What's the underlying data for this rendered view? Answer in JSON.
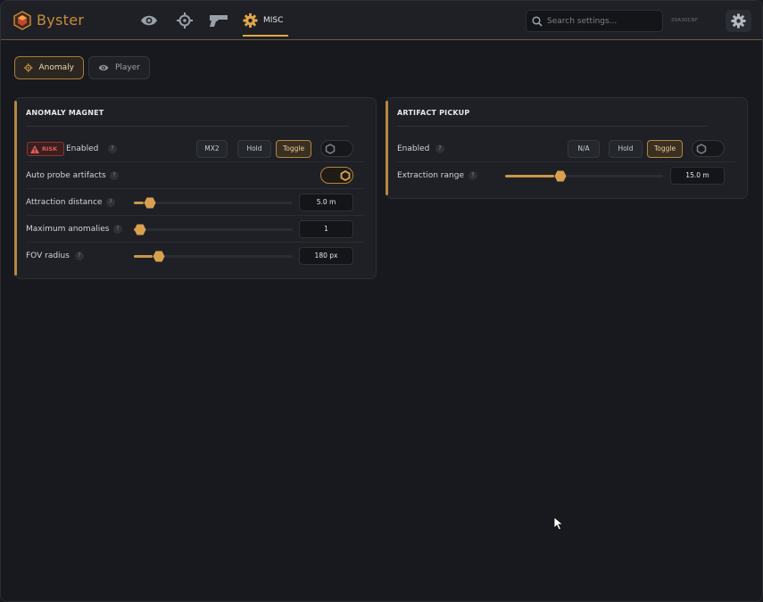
{
  "app": {
    "title": "Byster",
    "build_id": "20A30CBF",
    "accent": "#e0a64a"
  },
  "nav": {
    "tabs": [
      {
        "icon": "eye-icon"
      },
      {
        "icon": "crosshair-icon"
      },
      {
        "icon": "pistol-icon"
      },
      {
        "icon": "gear-icon",
        "label": "MISC",
        "active": true
      }
    ]
  },
  "search": {
    "placeholder": "Search settings..."
  },
  "subtabs": [
    {
      "label": "Anomaly",
      "icon": "crosshair-icon",
      "active": true
    },
    {
      "label": "Player",
      "icon": "eye-icon",
      "active": false
    }
  ],
  "anomaly_magnet": {
    "title": "ANOMALY MAGNET",
    "enabled": {
      "risk_label": "RISK",
      "label": "Enabled",
      "help": "?",
      "key": "MX2",
      "hold": "Hold",
      "toggle": "Toggle",
      "mode": "Toggle",
      "on": false
    },
    "auto_probe": {
      "label": "Auto probe artifacts",
      "help": "?",
      "on": true
    },
    "attraction_distance": {
      "label": "Attraction distance",
      "help": "?",
      "value": "5.0 m",
      "fraction": 0.06
    },
    "maximum_anomalies": {
      "label": "Maximum anomalies",
      "help": "?",
      "value": "1",
      "fraction": 0.0
    },
    "fov_radius": {
      "label": "FOV radius",
      "help": "?",
      "value": "180 px",
      "fraction": 0.12
    }
  },
  "artifact_pickup": {
    "title": "ARTIFACT PICKUP",
    "enabled": {
      "label": "Enabled",
      "help": "?",
      "key": "N/A",
      "hold": "Hold",
      "toggle": "Toggle",
      "mode": "Toggle",
      "on": false
    },
    "extraction_range": {
      "label": "Extraction range",
      "help": "?",
      "value": "15.0 m",
      "fraction": 0.31
    }
  }
}
